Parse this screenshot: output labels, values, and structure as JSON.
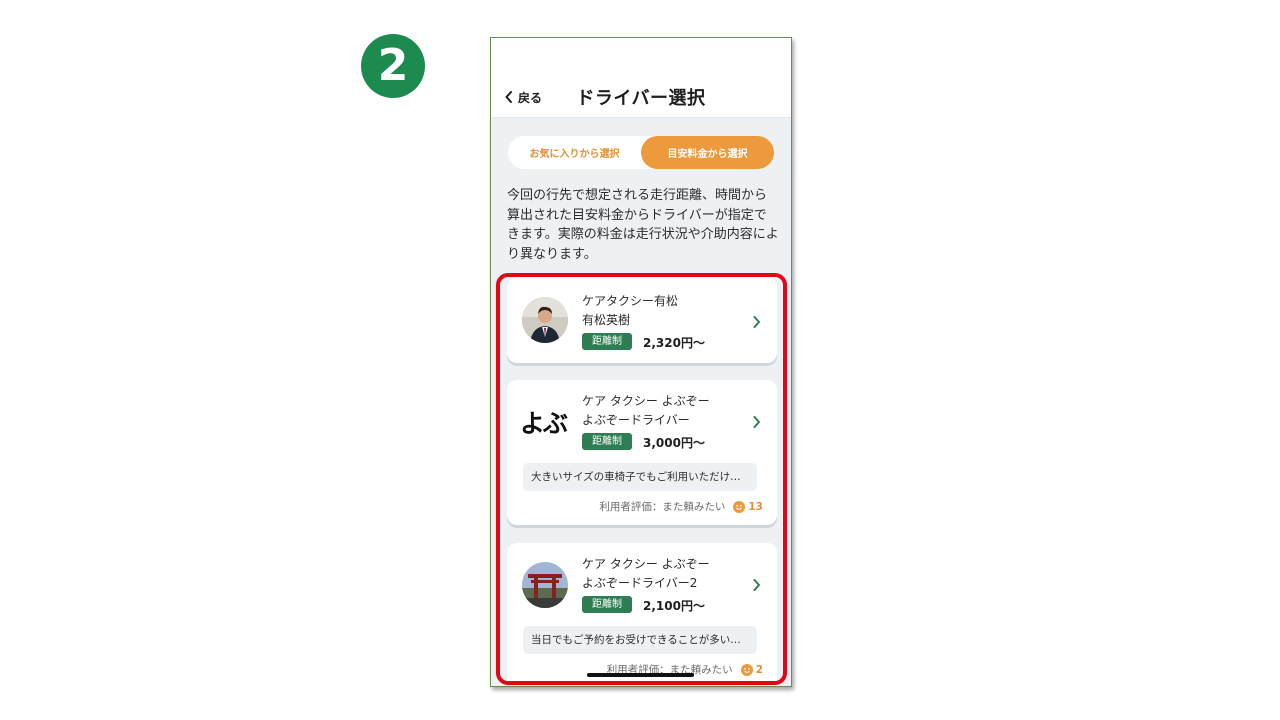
{
  "step": {
    "number": "2"
  },
  "header": {
    "back_label": "戻る",
    "title": "ドライバー選択"
  },
  "tabs": [
    {
      "label": "お気に入りから選択",
      "active": false
    },
    {
      "label": "目安料金から選択",
      "active": true
    }
  ],
  "description": "今回の行先で想定される走行距離、時間から算出された目安料金からドライバーが指定できます。実際の料金は走行状況や介助内容により異なります。",
  "drivers": [
    {
      "company": "ケアタクシー有松",
      "name": "有松英樹",
      "tag": "距離制",
      "price": "2,320円〜",
      "avatar_icon": "person-photo-icon"
    },
    {
      "company": "ケア タクシー よぶぞー",
      "name": "よぶぞードライバー",
      "tag": "距離制",
      "price": "3,000円〜",
      "logo_text": "よぶ",
      "note": "大きいサイズの車椅子でもご利用いただけ…",
      "rating_label": "利用者評価：また頼みたい",
      "rating_count": "13"
    },
    {
      "company": "ケア タクシー よぶぞー",
      "name": "よぶぞードライバー2",
      "tag": "距離制",
      "price": "2,100円〜",
      "avatar_icon": "shrine-photo-icon",
      "note": "当日でもご予約をお受けできることが多い…",
      "rating_label": "利用者評価：また頼みたい",
      "rating_count": "2"
    }
  ],
  "colors": {
    "accent_orange": "#ec9a3b",
    "tag_green": "#2f7d52",
    "badge_green": "#1d8a4f",
    "highlight_red": "#e30613"
  }
}
